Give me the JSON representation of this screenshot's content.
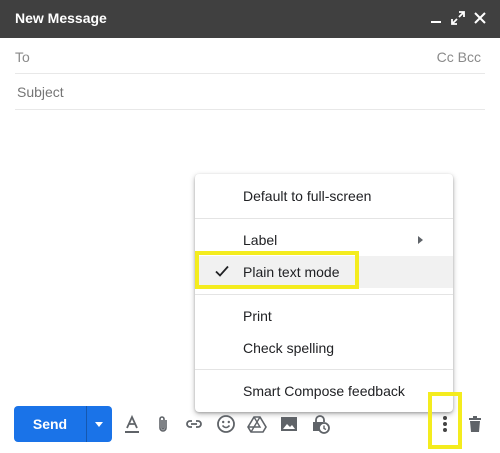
{
  "window": {
    "title": "New Message"
  },
  "header_icons": [
    "minimize-icon",
    "fullscreen-icon",
    "close-icon"
  ],
  "fields": {
    "to_label": "To",
    "cc_label": "Cc",
    "bcc_label": "Bcc",
    "subject_placeholder": "Subject"
  },
  "menu": {
    "items": [
      {
        "label": "Default to full-screen"
      },
      {
        "label": "Label",
        "has_submenu": true
      },
      {
        "label": "Plain text mode",
        "checked": true
      },
      {
        "label": "Print"
      },
      {
        "label": "Check spelling"
      },
      {
        "label": "Smart Compose feedback"
      }
    ]
  },
  "toolbar": {
    "send_label": "Send",
    "icons": [
      "formatting-icon",
      "attach-icon",
      "link-icon",
      "emoji-icon",
      "drive-icon",
      "photo-icon",
      "confidential-icon",
      "more-options-icon",
      "trash-icon"
    ]
  },
  "colors": {
    "header_bg": "#404040",
    "send_blue": "#1a73e8",
    "highlight_yellow": "#f4ec1e"
  }
}
